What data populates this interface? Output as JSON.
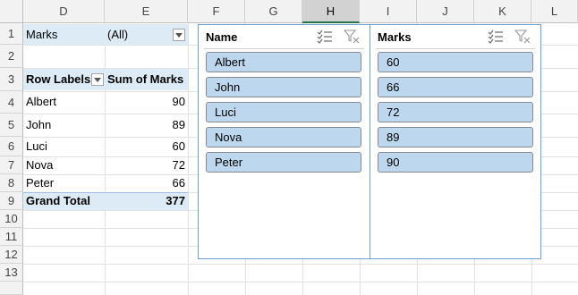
{
  "columns": [
    "D",
    "E",
    "F",
    "G",
    "H",
    "I",
    "J",
    "K",
    "L"
  ],
  "rows": [
    "1",
    "2",
    "3",
    "4",
    "5",
    "6",
    "7",
    "8",
    "9",
    "10",
    "11",
    "12",
    "13"
  ],
  "pivot": {
    "filter_field": "Marks",
    "filter_value": "(All)",
    "row_labels_header": "Row Labels",
    "sum_header": "Sum of Marks",
    "rows": [
      {
        "label": "Albert",
        "value": "90"
      },
      {
        "label": "John",
        "value": "89"
      },
      {
        "label": "Luci",
        "value": "60"
      },
      {
        "label": "Nova",
        "value": "72"
      },
      {
        "label": "Peter",
        "value": "66"
      }
    ],
    "grand_total_label": "Grand Total",
    "grand_total_value": "377"
  },
  "slicers": [
    {
      "title": "Name",
      "items": [
        "Albert",
        "John",
        "Luci",
        "Nova",
        "Peter"
      ]
    },
    {
      "title": "Marks",
      "items": [
        "60",
        "66",
        "72",
        "89",
        "90"
      ]
    }
  ],
  "icons": {
    "multi_select": "multi-select-icon",
    "clear_filter": "clear-filter-icon",
    "dropdown": "dropdown-arrow-icon"
  },
  "colors": {
    "pivot_fill": "#ddebf7",
    "slicer_item": "#bdd7ee",
    "slicer_border": "#6fa0d2",
    "selected_col_accent": "#217346"
  }
}
